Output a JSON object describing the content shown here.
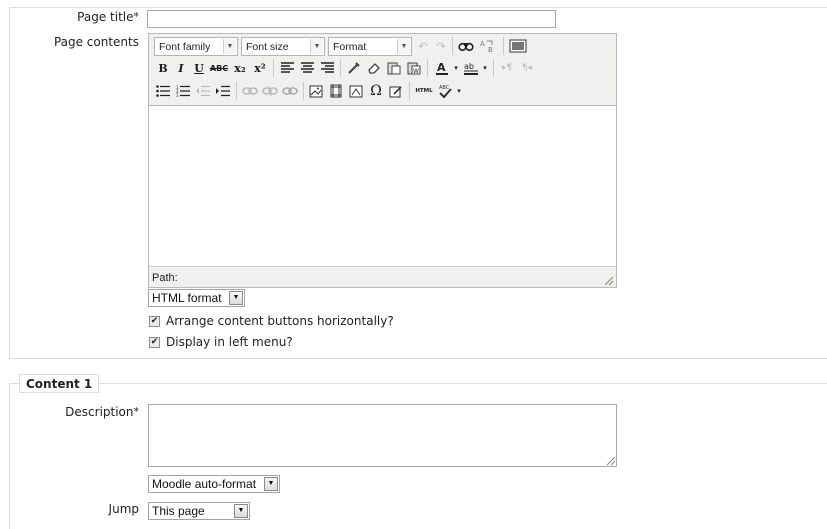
{
  "page_title_field": {
    "label": "Page title",
    "required_mark": "*",
    "value": ""
  },
  "page_contents": {
    "label": "Page contents",
    "toolbar": {
      "font_family": "Font family",
      "font_size": "Font size",
      "format": "Format",
      "row2_bold": "B",
      "row2_italic": "I",
      "row2_underline": "U",
      "row2_strike": "ABC",
      "row2_sub": "x₂",
      "row2_sup": "x²",
      "row3_html": "HTML"
    },
    "path_label": "Path:",
    "format_select": "HTML format"
  },
  "options": {
    "arrange_horizontally": {
      "label": "Arrange content buttons horizontally?",
      "checked": true
    },
    "display_left_menu": {
      "label": "Display in left menu?",
      "checked": true
    }
  },
  "content1": {
    "legend": "Content 1",
    "description_label": "Description",
    "required_mark": "*",
    "description_value": "",
    "format_select": "Moodle auto-format",
    "jump_label": "Jump",
    "jump_value": "This page"
  }
}
